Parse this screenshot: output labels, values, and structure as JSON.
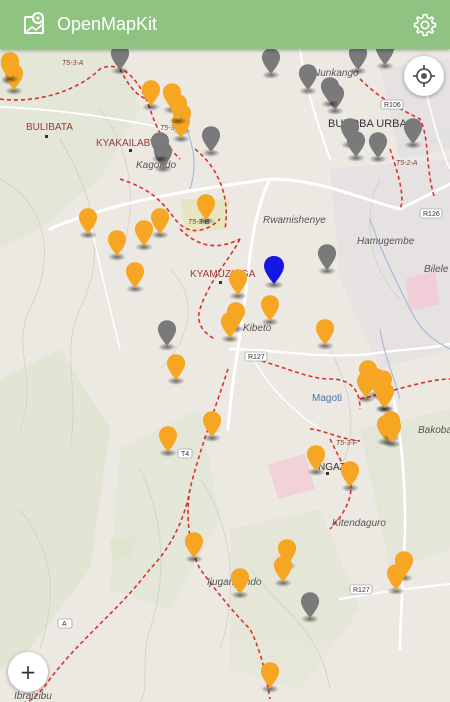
{
  "app": {
    "title": "OpenMapKit",
    "icon": "map-pin-icon"
  },
  "header": {
    "settings_icon": "gear-icon"
  },
  "controls": {
    "locate_icon": "crosshair-icon",
    "zoom_in_label": "+"
  },
  "colors": {
    "appbar": "#8fc382",
    "marker_orange": "#f6a623",
    "marker_gray": "#7a7a7a",
    "marker_blue": "#1515e6",
    "road_red": "#d9332b",
    "map_bg": "#ece8e2"
  },
  "map": {
    "place_labels": [
      "KYAKAILABWA",
      "BULIBATA",
      "Kagondo",
      "Rwamishenye",
      "Hamugembe",
      "Bilele",
      "KYAMUZINGA",
      "Kibeto",
      "BUKOBA URBAN",
      "Nunkango",
      "Magoti",
      "Bakoba",
      "NGAZI",
      "Kitendaguro",
      "Ijuganyondo",
      "Ibraizibu"
    ],
    "road_labels": [
      "T5-3-A",
      "T5-3-E",
      "T5-3-F",
      "T5-2-A",
      "R127",
      "R106",
      "R126",
      "T5-3-B",
      "T4",
      "R127",
      "A"
    ],
    "markers": {
      "orange_count": 40,
      "gray_count": 17,
      "selected_count": 1
    }
  }
}
